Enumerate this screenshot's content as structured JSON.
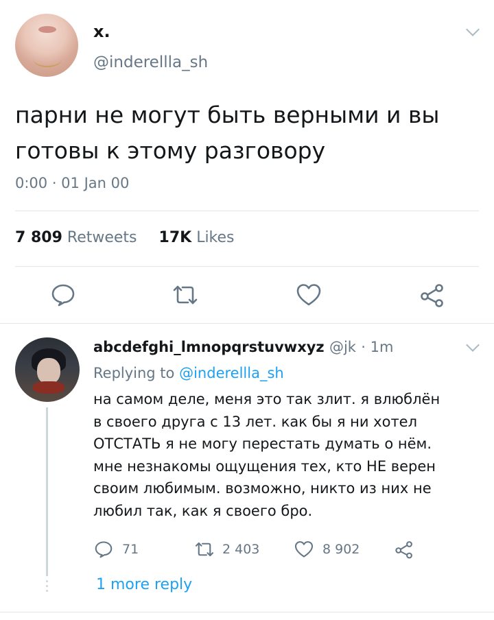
{
  "tweet": {
    "display_name": "x.",
    "handle": "@inderellla_sh",
    "text": "парни не могут быть верными и вы готовы к этому разговору",
    "timestamp": "0:00 · 01 Jan 00",
    "retweets_count": "7 809",
    "retweets_label": "Retweets",
    "likes_count": "17K",
    "likes_label": "Likes",
    "actions": {
      "reply_icon": "reply-icon",
      "retweet_icon": "retweet-icon",
      "like_icon": "heart-icon",
      "share_icon": "share-icon"
    }
  },
  "reply": {
    "display_name": "abcdefghi_lmnopqrstuvwxyz",
    "handle": "@jk",
    "time": "· 1m",
    "replying_prefix": "Replying to",
    "replying_to": "@inderellla_sh",
    "text": "на самом деле, меня это так злит. я влюблён\nв своего друга с 13 лет. как бы я ни хотел\nОТСТАТЬ я не могу перестать думать о нём.\nмне незнакомы ощущения тех, кто НЕ верен\nсвоим любимым. возможно, никто из них не\nлюбил так, как я своего бро.",
    "reply_count": "71",
    "retweet_count": "2 403",
    "like_count": "8 902",
    "more_replies": "1 more reply"
  },
  "colors": {
    "accent": "#1da1f2",
    "secondary_text": "#657786",
    "icon": "#657786",
    "divider": "#e1e8ed"
  }
}
